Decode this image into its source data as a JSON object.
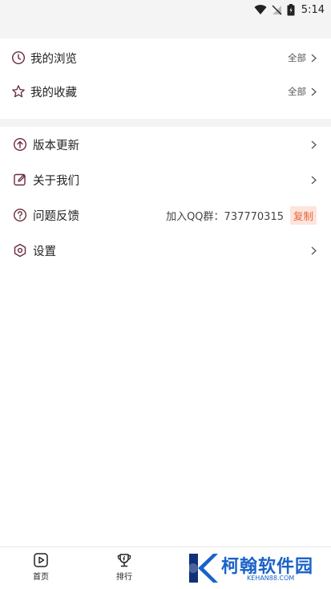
{
  "status_bar": {
    "time": "5:14"
  },
  "section_history": {
    "items": [
      {
        "label": "我的浏览",
        "right_label": "全部",
        "icon": "clock-icon"
      },
      {
        "label": "我的收藏",
        "right_label": "全部",
        "icon": "star-icon"
      }
    ]
  },
  "section_settings": {
    "items": [
      {
        "label": "版本更新",
        "icon": "arrow-up-circle-icon"
      },
      {
        "label": "关于我们",
        "icon": "edit-icon"
      },
      {
        "label": "问题反馈",
        "icon": "question-circle-icon",
        "info": "加入QQ群：737770315",
        "action": "复制"
      },
      {
        "label": "设置",
        "icon": "gear-icon"
      }
    ]
  },
  "bottom_nav": {
    "items": [
      {
        "label": "首页",
        "icon": "play-icon"
      },
      {
        "label": "排行",
        "icon": "trophy-icon"
      }
    ]
  },
  "watermark": {
    "text": "柯翰软件园",
    "sub": "KEHAN88.COM"
  },
  "colors": {
    "accent": "#e8623a",
    "icon": "#6b2a3a",
    "copy_bg": "#fde4dc"
  }
}
